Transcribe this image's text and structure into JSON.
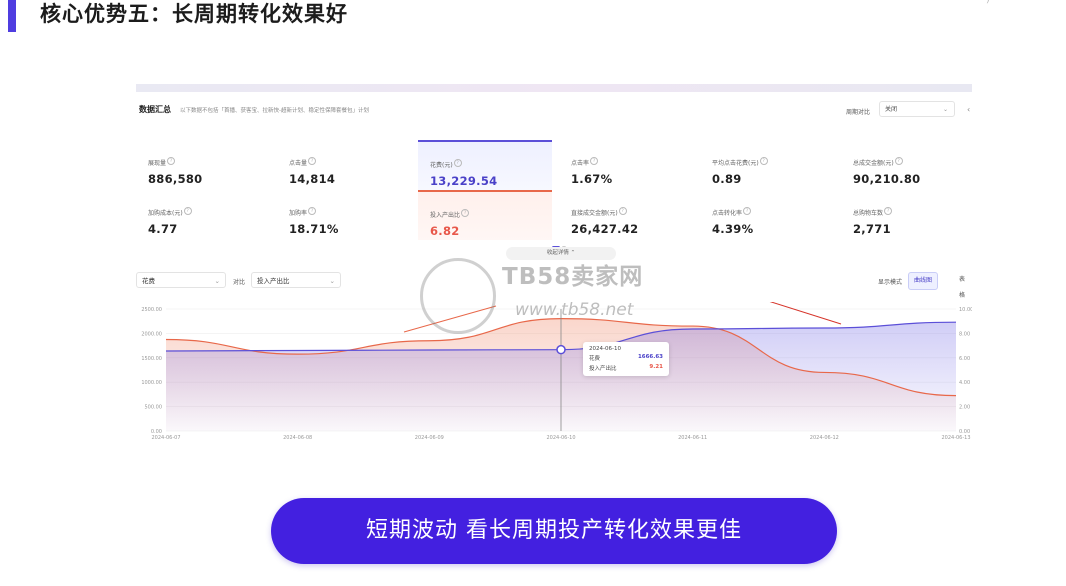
{
  "page": {
    "title": "核心优势五：长周期转化效果好",
    "cta": "短期波动  看长周期投产转化效果更佳"
  },
  "panel": {
    "header": "数据汇总",
    "note": "以下数据不包括「首播、获客宝、拉新快-超新计划、稳定性保障套餐包」计划",
    "period_label": "周期对比",
    "period_value": "关闭"
  },
  "metrics": [
    {
      "label": "展现量",
      "value": "886,580"
    },
    {
      "label": "点击量",
      "value": "14,814"
    },
    {
      "label": "花费(元)",
      "value": "13,229.54"
    },
    {
      "label": "点击率",
      "value": "1.67%"
    },
    {
      "label": "平均点击花费(元)",
      "value": "0.89"
    },
    {
      "label": "总成交金额(元)",
      "value": "90,210.80"
    },
    {
      "label": "加购成本(元)",
      "value": "4.77"
    },
    {
      "label": "加购率",
      "value": "18.71%"
    },
    {
      "label": "投入产出比",
      "value": "6.82"
    },
    {
      "label": "直接成交金额(元)",
      "value": "26,427.42"
    },
    {
      "label": "点击转化率",
      "value": "4.39%"
    },
    {
      "label": "总购物车数",
      "value": "2,771"
    }
  ],
  "controls": {
    "collapse": "收起详情",
    "metric_a": "花费",
    "compare_label": "对比",
    "metric_b": "投入产出比",
    "mode_label": "显示模式",
    "mode_chart": "曲线图",
    "mode_table": "表格"
  },
  "tooltip": {
    "date": "2024-06-10",
    "a_label": "花费",
    "a_value": "1666.63",
    "b_label": "投入产出比",
    "b_value": "9.21"
  },
  "watermark": {
    "text": "TB58卖家网",
    "url": "www.tb58.net"
  },
  "chart_data": {
    "type": "area",
    "x": [
      "2024-06-07",
      "2024-06-08",
      "2024-06-09",
      "2024-06-10",
      "2024-06-11",
      "2024-06-12",
      "2024-06-13"
    ],
    "series": [
      {
        "name": "花费",
        "axis": "left",
        "color": "#5b4fd8",
        "values": [
          1640,
          1650,
          1660,
          1666.63,
          2090,
          2110,
          2230
        ]
      },
      {
        "name": "投入产出比",
        "axis": "right",
        "color": "#e8684a",
        "values": [
          7.5,
          6.3,
          7.4,
          9.21,
          8.6,
          4.8,
          2.9
        ]
      }
    ],
    "y_left": {
      "ticks": [
        "0.00",
        "500.00",
        "1000.00",
        "1500.00",
        "2000.00",
        "2500.00"
      ],
      "ylim": [
        0,
        2500
      ]
    },
    "y_right": {
      "ticks": [
        "0.00",
        "2.00",
        "4.00",
        "6.00",
        "8.00",
        "10.00"
      ],
      "ylim": [
        0,
        10
      ]
    },
    "grid": true
  }
}
